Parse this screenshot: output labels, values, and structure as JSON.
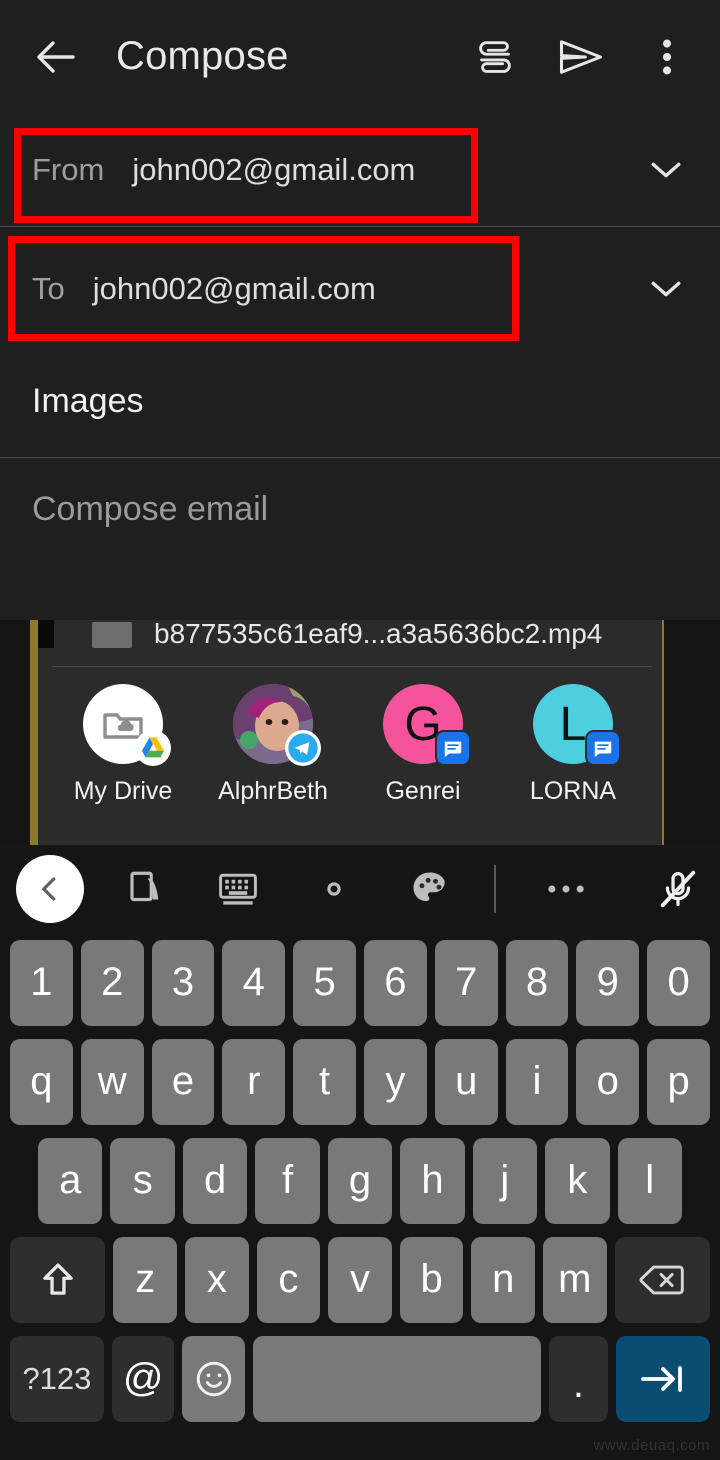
{
  "appbar": {
    "back_icon": "back-arrow-icon",
    "title": "Compose",
    "attach_icon": "paperclip-icon",
    "send_icon": "send-icon",
    "more_icon": "overflow-menu-icon"
  },
  "fields": {
    "from": {
      "label": "From",
      "value": "john002@gmail.com",
      "chevron_icon": "chevron-down-icon"
    },
    "to": {
      "label": "To",
      "value": "john002@gmail.com",
      "chevron_icon": "chevron-down-icon"
    }
  },
  "subject": {
    "value": "Images"
  },
  "body": {
    "placeholder": "Compose email",
    "value": ""
  },
  "annotations": {
    "color": "#fe0000",
    "boxes": [
      {
        "name": "from-field-highlight"
      },
      {
        "name": "to-field-highlight"
      }
    ]
  },
  "sharesheet": {
    "file_name": "b877535c61eaf9...a3a5636bc2.mp4",
    "targets": [
      {
        "label": "My Drive",
        "avatar_initial": "",
        "avatar_color": "#ffffff",
        "badge": "google-drive-badge",
        "icon": "folder-cloud-icon"
      },
      {
        "label": "AlphrBeth",
        "avatar_initial": "",
        "avatar_color": "#9c7f9f",
        "badge": "telegram-badge",
        "icon": "photo-avatar"
      },
      {
        "label": "Genrei",
        "avatar_initial": "G",
        "avatar_color": "#f5539b",
        "badge": "messages-badge",
        "icon": "letter-avatar"
      },
      {
        "label": "LORNA",
        "avatar_initial": "L",
        "avatar_color": "#4ecfe0",
        "badge": "messages-badge",
        "icon": "letter-avatar"
      }
    ]
  },
  "keyboard": {
    "toolbar": [
      {
        "name": "back-button",
        "icon": "chevron-left-icon"
      },
      {
        "name": "handwriting-button",
        "icon": "handwriting-icon"
      },
      {
        "name": "keyboard-layout-button",
        "icon": "keyboard-icon"
      },
      {
        "name": "settings-button",
        "icon": "gear-icon"
      },
      {
        "name": "theme-button",
        "icon": "palette-icon"
      },
      {
        "name": "divider",
        "icon": "vertical-divider"
      },
      {
        "name": "more-button",
        "icon": "three-dots-icon"
      },
      {
        "name": "mic-button",
        "icon": "microphone-muted-icon"
      }
    ],
    "rows": [
      [
        "1",
        "2",
        "3",
        "4",
        "5",
        "6",
        "7",
        "8",
        "9",
        "0"
      ],
      [
        "q",
        "w",
        "e",
        "r",
        "t",
        "y",
        "u",
        "i",
        "o",
        "p"
      ],
      [
        "a",
        "s",
        "d",
        "f",
        "g",
        "h",
        "j",
        "k",
        "l"
      ],
      [
        "z",
        "x",
        "c",
        "v",
        "b",
        "n",
        "m"
      ]
    ],
    "shift_label": "shift-icon",
    "backspace_label": "backspace-icon",
    "symbols_label": "?123",
    "at_label": "@",
    "emoji_label": "emoji-icon",
    "space_label": "",
    "period_label": ".",
    "enter_label": "tab-next-icon",
    "enter_color": "#0b4c72"
  },
  "watermark": {
    "text": "www.deuaq.com"
  }
}
